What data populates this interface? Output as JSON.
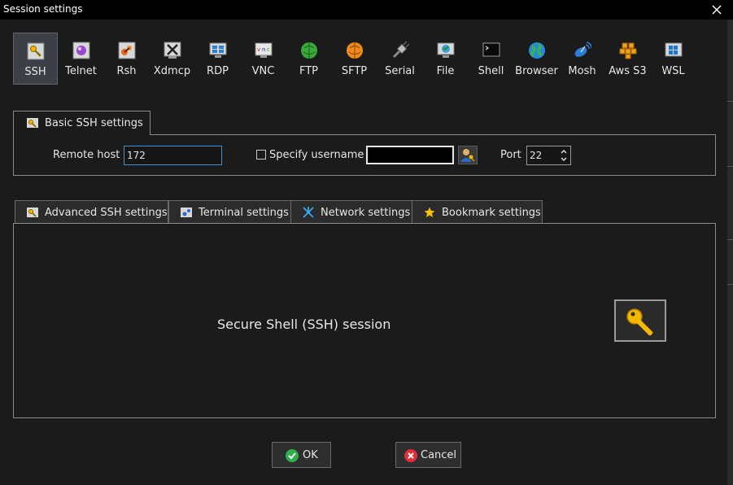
{
  "window": {
    "title": "Session settings",
    "close_glyph": "✕"
  },
  "protocols": [
    {
      "label": "SSH",
      "icon": "key-icon",
      "selected": true
    },
    {
      "label": "Telnet",
      "icon": "telnet-icon",
      "selected": false
    },
    {
      "label": "Rsh",
      "icon": "rsh-icon",
      "selected": false
    },
    {
      "label": "Xdmcp",
      "icon": "xdmcp-icon",
      "selected": false
    },
    {
      "label": "RDP",
      "icon": "rdp-icon",
      "selected": false
    },
    {
      "label": "VNC",
      "icon": "vnc-icon",
      "selected": false
    },
    {
      "label": "FTP",
      "icon": "ftp-icon",
      "selected": false
    },
    {
      "label": "SFTP",
      "icon": "sftp-icon",
      "selected": false
    },
    {
      "label": "Serial",
      "icon": "serial-icon",
      "selected": false
    },
    {
      "label": "File",
      "icon": "file-icon",
      "selected": false
    },
    {
      "label": "Shell",
      "icon": "shell-icon",
      "selected": false
    },
    {
      "label": "Browser",
      "icon": "browser-icon",
      "selected": false
    },
    {
      "label": "Mosh",
      "icon": "mosh-icon",
      "selected": false
    },
    {
      "label": "Aws S3",
      "icon": "aws-s3-icon",
      "selected": false
    },
    {
      "label": "WSL",
      "icon": "wsl-icon",
      "selected": false
    }
  ],
  "basic": {
    "tab_label": "Basic SSH settings",
    "remote_host_label": "Remote host *",
    "remote_host_value": "172",
    "specify_username_label": "Specify username",
    "specify_username_checked": false,
    "username_value": "",
    "port_label": "Port",
    "port_value": "22"
  },
  "tabs": [
    {
      "label": "Advanced SSH settings",
      "icon": "key-icon"
    },
    {
      "label": "Terminal settings",
      "icon": "terminal-icon"
    },
    {
      "label": "Network settings",
      "icon": "network-icon"
    },
    {
      "label": "Bookmark settings",
      "icon": "star-icon"
    }
  ],
  "content": {
    "description": "Secure Shell (SSH) session",
    "icon": "key-icon"
  },
  "buttons": {
    "ok_label": "OK",
    "cancel_label": "Cancel"
  },
  "colors": {
    "background": "#1b1b1b",
    "titlebar": "#000000",
    "selected_protocol_bg": "#3c3f45",
    "focus_border": "#4a90c8",
    "key_gold": "#f5b800",
    "ok_green": "#2fae4a",
    "cancel_red": "#e0303a"
  }
}
